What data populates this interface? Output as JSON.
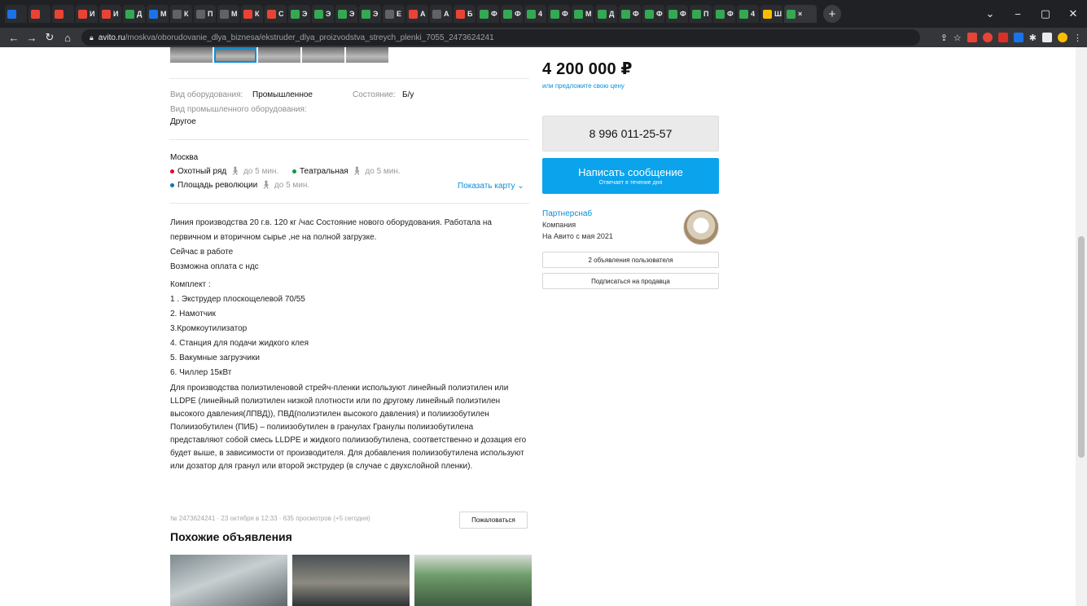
{
  "browser": {
    "tabs": [
      {
        "letter": "",
        "color": "#1a73e8"
      },
      {
        "letter": "",
        "color": "#ea4335"
      },
      {
        "letter": "",
        "color": "#ea4335"
      },
      {
        "letter": "И",
        "color": "#ea4335"
      },
      {
        "letter": "И",
        "color": "#ea4335"
      },
      {
        "letter": "Д",
        "color": "#34a853"
      },
      {
        "letter": "М",
        "color": "#1a73e8"
      },
      {
        "letter": "К",
        "color": "#5f6368"
      },
      {
        "letter": "П",
        "color": "#5f6368"
      },
      {
        "letter": "М",
        "color": "#5f6368"
      },
      {
        "letter": "К",
        "color": "#ea4335"
      },
      {
        "letter": "C",
        "color": "#ea4335"
      },
      {
        "letter": "Э",
        "color": "#34a853"
      },
      {
        "letter": "Э",
        "color": "#34a853"
      },
      {
        "letter": "Э",
        "color": "#34a853"
      },
      {
        "letter": "Э",
        "color": "#34a853"
      },
      {
        "letter": "Е",
        "color": "#5f6368"
      },
      {
        "letter": "А",
        "color": "#ea4335"
      },
      {
        "letter": "А",
        "color": "#5f6368"
      },
      {
        "letter": "Б",
        "color": "#ea4335"
      },
      {
        "letter": "Ф",
        "color": "#34a853"
      },
      {
        "letter": "Ф",
        "color": "#34a853"
      },
      {
        "letter": "4",
        "color": "#34a853"
      },
      {
        "letter": "Ф",
        "color": "#34a853"
      },
      {
        "letter": "М",
        "color": "#34a853"
      },
      {
        "letter": "Д",
        "color": "#34a853"
      },
      {
        "letter": "Ф",
        "color": "#34a853"
      },
      {
        "letter": "Ф",
        "color": "#34a853"
      },
      {
        "letter": "Ф",
        "color": "#34a853"
      },
      {
        "letter": "П",
        "color": "#34a853"
      },
      {
        "letter": "Ф",
        "color": "#34a853"
      },
      {
        "letter": "4",
        "color": "#34a853"
      },
      {
        "letter": "Ш",
        "color": "#fbbc04"
      }
    ],
    "active_tab_label": "×",
    "new_tab": "+",
    "url_host": "avito.ru",
    "url_path": "/moskva/oborudovanie_dlya_biznesa/ekstruder_dlya_proizvodstva_streych_plenki_7055_2473624241",
    "controls": {
      "minimize": "−",
      "maximize": "▢",
      "close": "✕",
      "dropdown": "⌄"
    }
  },
  "params": {
    "type_label": "Вид оборудования:",
    "type_value": "Промышленное",
    "condition_label": "Состояние:",
    "condition_value": "Б/у",
    "industrial_label": "Вид промышленного оборудования:",
    "industrial_value": "Другое"
  },
  "location": {
    "city": "Москва",
    "metro": [
      {
        "name": "Охотный ряд",
        "time": "до 5 мин.",
        "color": "#e4002b"
      },
      {
        "name": "Театральная",
        "time": "до 5 мин.",
        "color": "#0a9a3c"
      },
      {
        "name": "Площадь революции",
        "time": "до 5 мин.",
        "color": "#0078bf"
      }
    ],
    "show_map": "Показать карту"
  },
  "description": {
    "intro_1": "Линия производства 20 г.в. 120 кг /час Состояние нового оборудования. Работала на",
    "intro_2": "первичном и вторичном сырье ,не на полной загрузке.",
    "working": "Сейчас в работе",
    "vat": "Возможна оплата с ндс",
    "kit_title": "Комплект :",
    "kit": [
      "1 . Экструдер плоскощелевой 70/55",
      "2. Намотчик",
      "3.Кромкоутилизатор",
      "4. Станция для подачи жидкого клея",
      "5. Вакумные загрузчики",
      "6. Чиллер 15кВт"
    ],
    "long_text": "Для производства полиэтиленовой стрейч-пленки используют линейный полиэтилен или LLDPE (линейный полиэтилен низкой плотности или по другому линейный полиэтилен высокого давления(ЛПВД)), ПВД(полиэтилен высокого давления) и полиизобутилен Полиизобутилен (ПИБ) – полиизобутилен в гранулах Гранулы полиизобутилена представляют собой смесь LLDPE и жидкого полиизобутилена, соответственно и дозация его будет выше, в зависимости от производителя. Для добавления полиизобутилена используют или дозатор для гранул или второй экструдер (в случае с двухслойной пленки)."
  },
  "meta": {
    "info": "№ 2473624241 · 23 октября в 12:33 · 635 просмотров (+5 сегодня)",
    "report": "Пожаловаться"
  },
  "similar": {
    "title": "Похожие объявления"
  },
  "sidebar": {
    "price": "4 200 000 ₽",
    "offer": "или предложите свою цену",
    "phone": "8 996 011-25-57",
    "message": "Написать сообщение",
    "message_sub": "Отвечает в течение дня",
    "seller_name": "Партнерснаб",
    "seller_type": "Компания",
    "seller_since": "На Авито с мая 2021",
    "ads_button": "2 объявления пользователя",
    "subscribe_button": "Подписаться на продавца"
  }
}
